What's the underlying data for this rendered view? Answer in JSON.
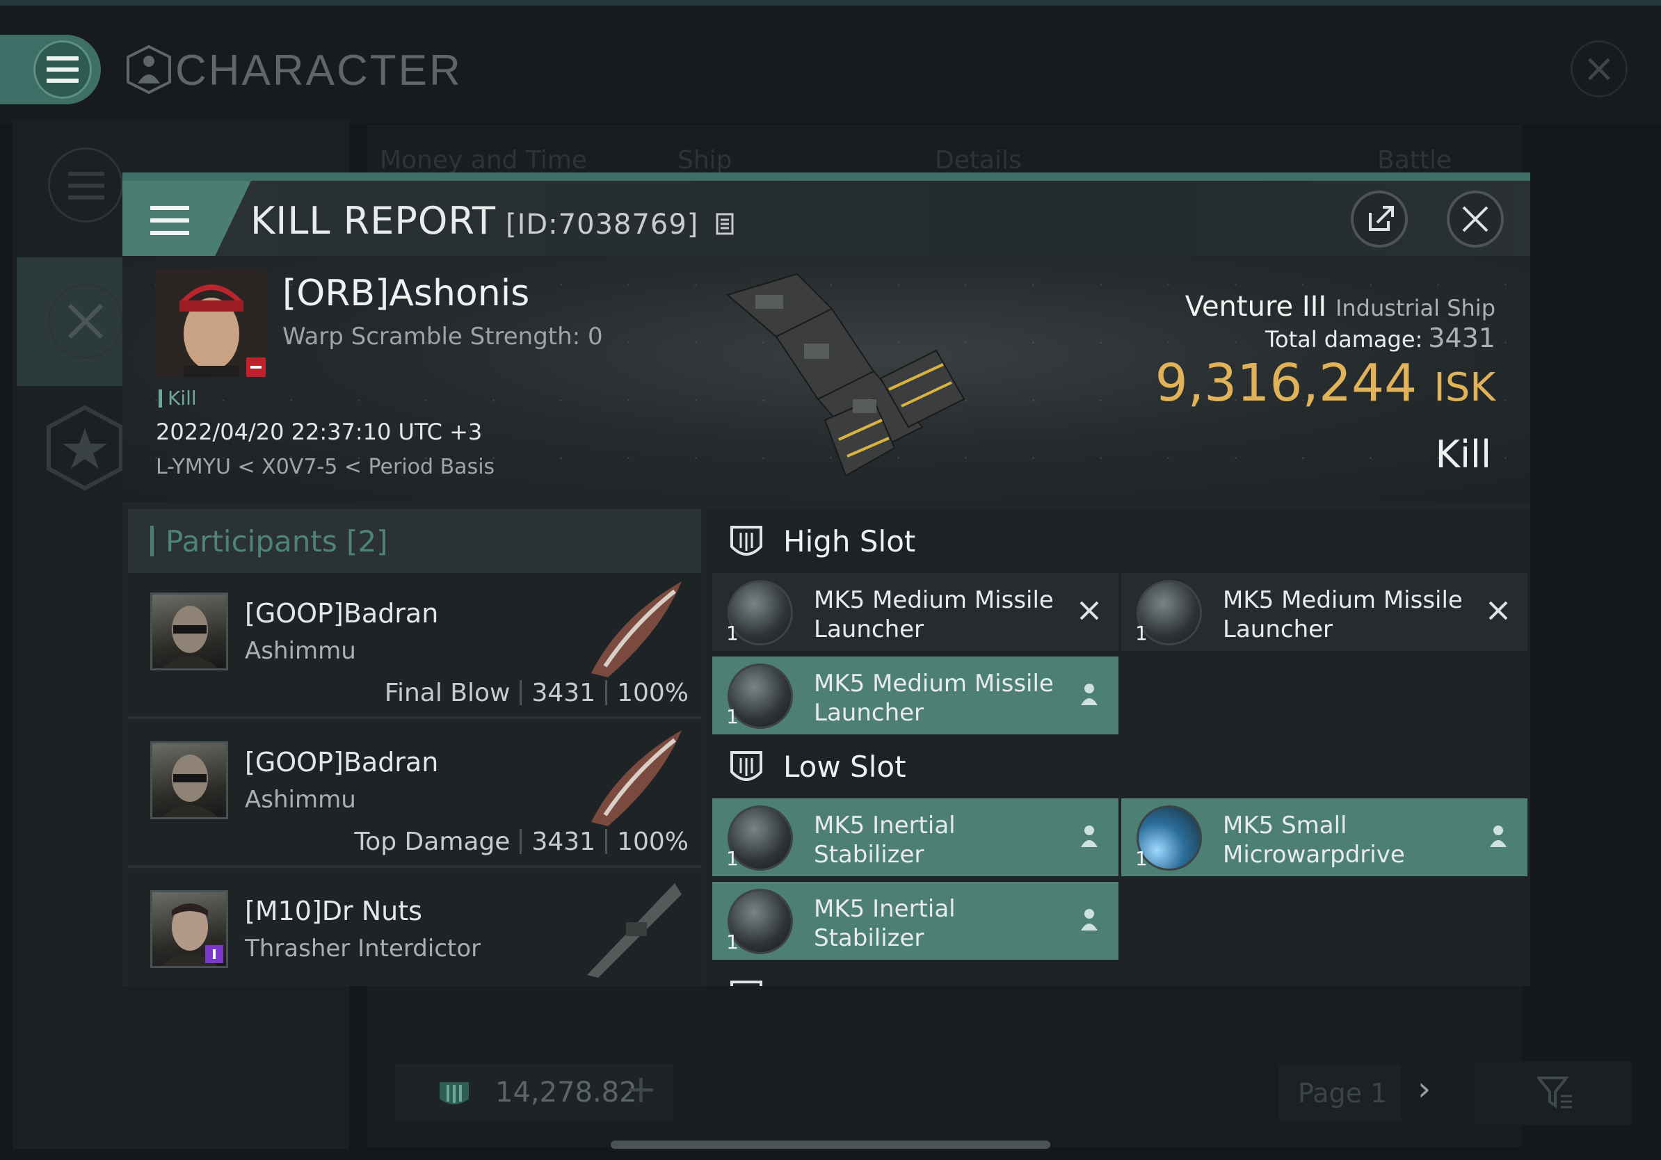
{
  "app": {
    "title": "CHARACTER",
    "bg_tabs": [
      "Money and Time",
      "Ship",
      "Details",
      "Battle Status"
    ],
    "footer": {
      "balance": "14,278.82",
      "page": "Page 1"
    }
  },
  "kill_report": {
    "title": "KILL REPORT",
    "id": "[ID:7038769]",
    "victim": {
      "name": "[ORB]Ashonis",
      "warp_scramble": "Warp Scramble Strength: 0",
      "status_tag": "Kill",
      "datetime": "2022/04/20 22:37:10 UTC +3",
      "location": "L-YMYU < X0V7-5 < Period Basis"
    },
    "ship": {
      "name": "Venture III",
      "class": "Industrial Ship",
      "total_damage_label": "Total damage:",
      "total_damage": "3431",
      "isk_value": "9,316,244",
      "isk_unit": "ISK",
      "result": "Kill"
    },
    "participants": {
      "title": "Participants [2]",
      "rows": [
        {
          "name": "[GOOP]Badran",
          "ship": "Ashimmu",
          "role": "Final Blow",
          "damage": "3431",
          "percent": "100%"
        },
        {
          "name": "[GOOP]Badran",
          "ship": "Ashimmu",
          "role": "Top Damage",
          "damage": "3431",
          "percent": "100%"
        },
        {
          "name": "[M10]Dr Nuts",
          "ship": "Thrasher Interdictor",
          "role": "",
          "damage": "",
          "percent": ""
        }
      ]
    },
    "fitting": {
      "high_slot_label": "High Slot",
      "low_slot_label": "Low Slot",
      "high_items": [
        {
          "name": "MK5 Medium Missile Launcher",
          "qty": "1",
          "state": "destroyed"
        },
        {
          "name": "MK5 Medium Missile Launcher",
          "qty": "1",
          "state": "destroyed"
        },
        {
          "name": "MK5 Medium Missile Launcher",
          "qty": "1",
          "state": "dropped"
        }
      ],
      "low_items": [
        {
          "name": "MK5 Inertial Stabilizer",
          "qty": "1",
          "state": "dropped"
        },
        {
          "name": "MK5 Small Microwarpdrive",
          "qty": "1",
          "state": "dropped"
        },
        {
          "name": "MK5 Inertial Stabilizer",
          "qty": "1",
          "state": "dropped"
        }
      ]
    }
  },
  "colors": {
    "accent_teal": "#4d7f75",
    "isk_gold": "#e0b25a",
    "background": "#14181a"
  },
  "icons": [
    "hamburger-icon",
    "character-icon",
    "close-icon",
    "share-icon",
    "shield-slot-icon",
    "crossed-swords-icon",
    "star-icon",
    "person-icon",
    "destroyed-x-icon",
    "filter-icon",
    "isk-icon"
  ]
}
